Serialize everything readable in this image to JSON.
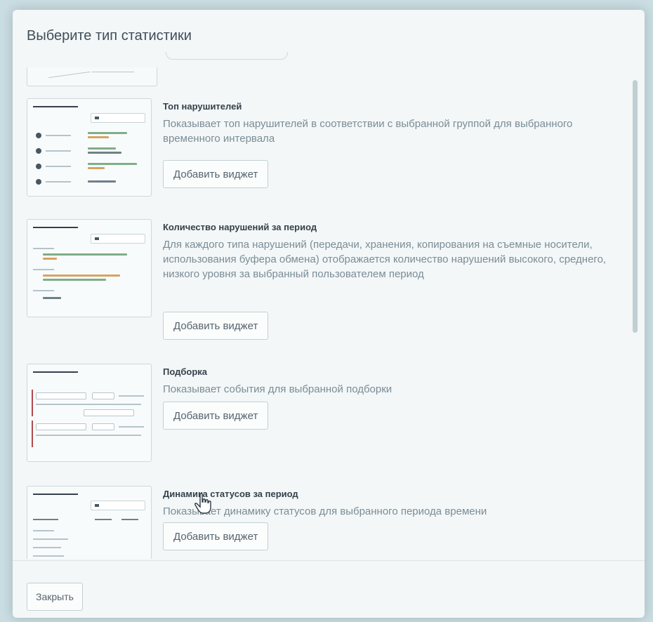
{
  "modal": {
    "title": "Выберите тип статистики",
    "close_label": "Закрыть"
  },
  "widgets": [
    {
      "title": "Топ нарушителей",
      "description": "Показывает топ нарушителей в соответствии с выбранной группой для выбранного временного интервала",
      "button_label": "Добавить виджет"
    },
    {
      "title": "Количество нарушений за период",
      "description": "Для каждого типа нарушений (передачи, хранения, копирования на съемные носители, использования буфера обмена) отображается количество нарушений высокого, среднего, низкого уровня за выбранный пользователем период",
      "button_label": "Добавить виджет"
    },
    {
      "title": "Подборка",
      "description": "Показывает события для выбранной подборки",
      "button_label": "Добавить виджет"
    },
    {
      "title": "Динамика статусов за период",
      "description": "Показывает динамику статусов для выбранного периода времени",
      "button_label": "Добавить виджет"
    }
  ],
  "colors": {
    "bar_green": "#7fae8a",
    "bar_orange": "#d6a460",
    "bar_gray": "#6f7f88",
    "accent_red": "#b04a4a"
  }
}
